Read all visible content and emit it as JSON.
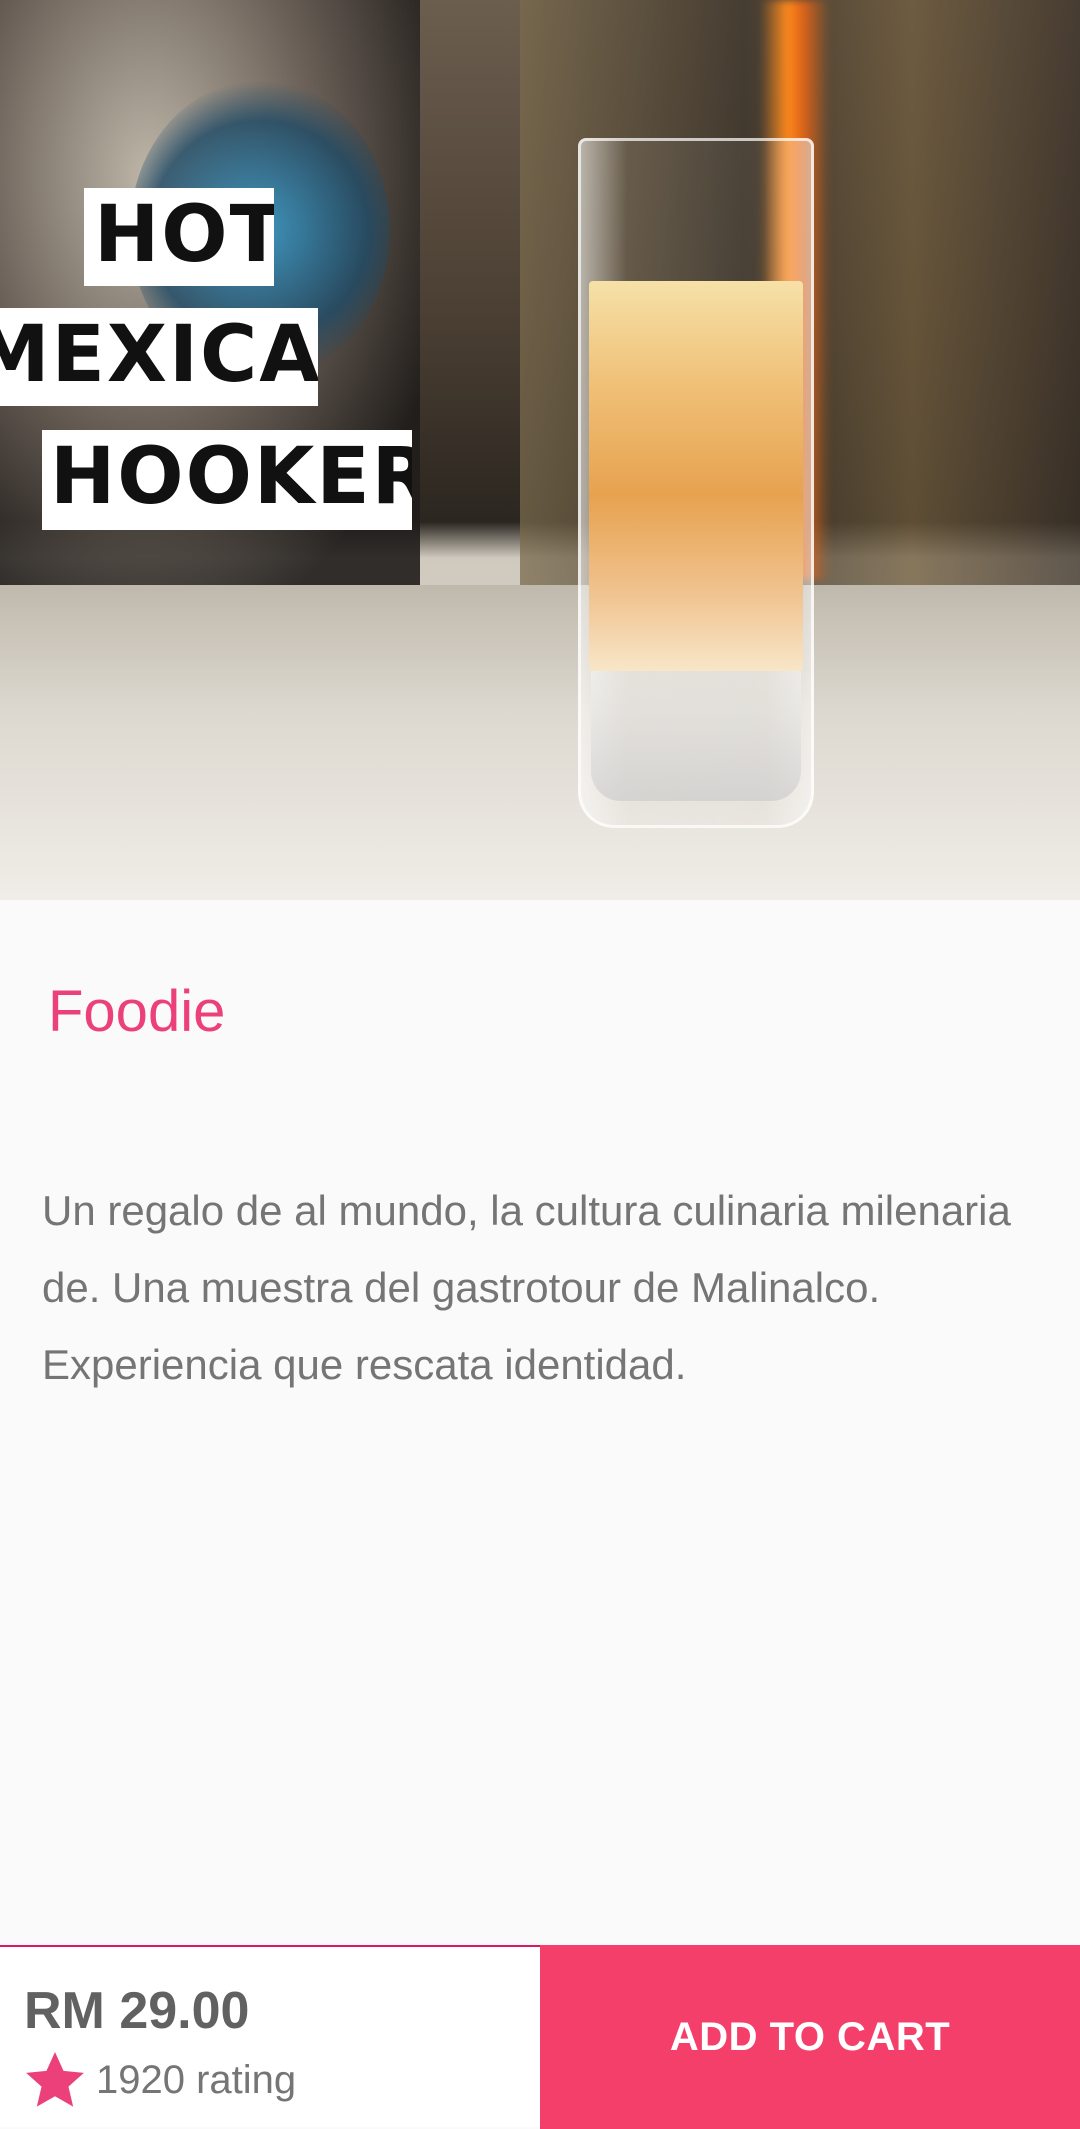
{
  "hero": {
    "sign_lines": [
      "HOT",
      "MEXICAN",
      "HOOKER"
    ]
  },
  "product": {
    "title": "Foodie",
    "description": "Un regalo de al mundo, la cultura culinaria milenaria de. Una muestra del gastrotour de Malinalco. Experiencia que rescata identidad.",
    "price": "RM 29.00",
    "rating_text": "1920 rating",
    "rating_icon": "star-icon"
  },
  "actions": {
    "add_to_cart_label": "ADD TO CART"
  },
  "colors": {
    "accent": "#ec407a",
    "button": "#f43f6b",
    "text_primary": "#616161",
    "text_secondary": "#757575",
    "background": "#fafafa"
  }
}
